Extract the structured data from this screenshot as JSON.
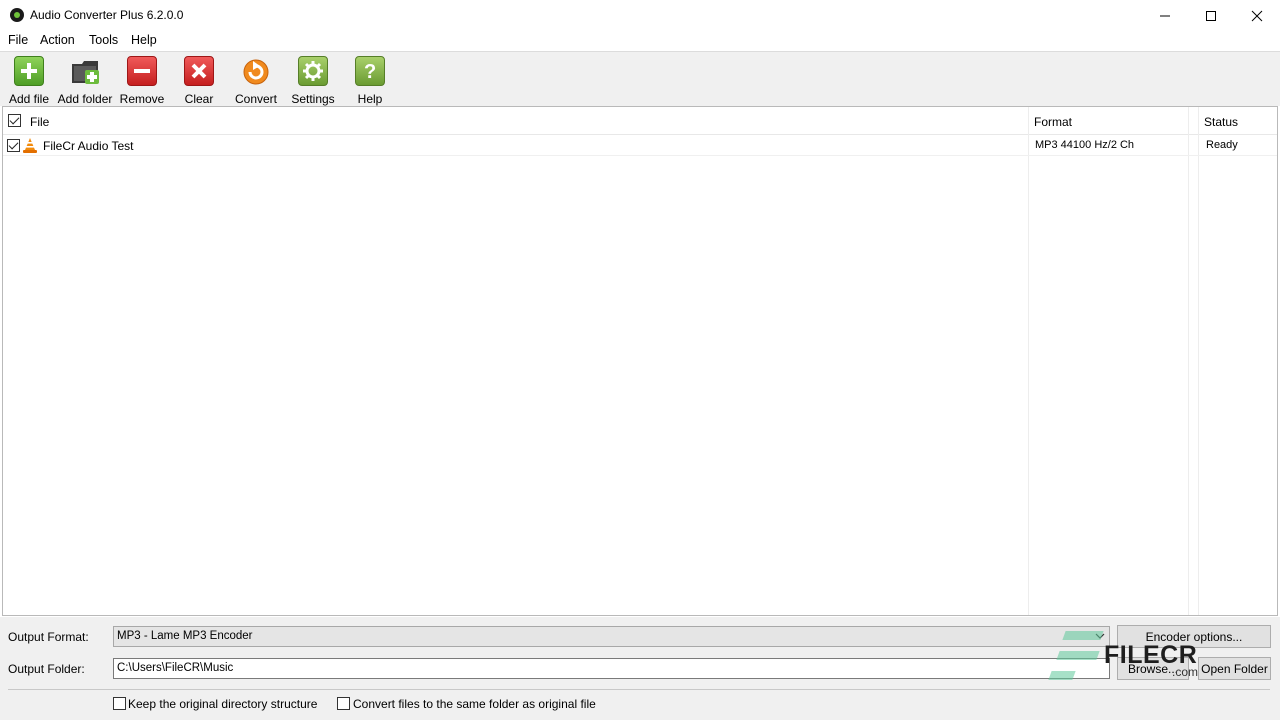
{
  "window": {
    "title": "Audio Converter Plus 6.2.0.0"
  },
  "menu": [
    "File",
    "Action",
    "Tools",
    "Help"
  ],
  "toolbar": [
    {
      "label": "Add file",
      "icon": "add-file-icon"
    },
    {
      "label": "Add folder",
      "icon": "add-folder-icon"
    },
    {
      "label": "Remove",
      "icon": "remove-icon"
    },
    {
      "label": "Clear",
      "icon": "clear-icon"
    },
    {
      "label": "Convert",
      "icon": "convert-icon"
    },
    {
      "label": "Settings",
      "icon": "settings-icon"
    },
    {
      "label": "Help",
      "icon": "help-icon"
    }
  ],
  "list": {
    "columns": {
      "file": "File",
      "format": "Format",
      "status": "Status"
    },
    "rows": [
      {
        "checked": true,
        "file": "FileCr Audio Test",
        "format": "MP3 44100 Hz/2 Ch",
        "status": "Ready"
      }
    ]
  },
  "output": {
    "format_label": "Output Format:",
    "format_value": "MP3  - Lame MP3 Encoder",
    "folder_label": "Output Folder:",
    "folder_value": "C:\\Users\\FileCR\\Music",
    "encoder_button": "Encoder options...",
    "browse_button": "Browse...",
    "open_folder_button": "Open Folder"
  },
  "options": {
    "keep_structure": "Keep the original directory structure",
    "same_folder": "Convert files to the same folder as original file"
  },
  "watermark": {
    "brand": "FILECR",
    "suffix": ".com"
  },
  "colors": {
    "accent_green": "#4e9e25",
    "danger_red": "#c51f1f",
    "convert_orange": "#f08a1e",
    "watermark_green": "#5fc99a"
  }
}
